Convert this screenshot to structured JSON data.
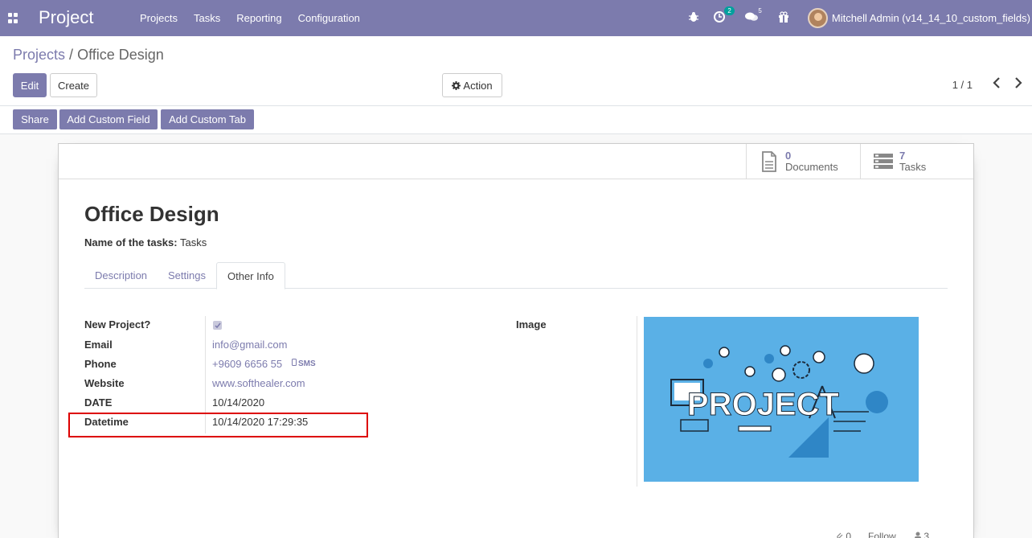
{
  "navbar": {
    "brand": "Project",
    "menu": [
      "Projects",
      "Tasks",
      "Reporting",
      "Configuration"
    ],
    "activity_count": "2",
    "messages_count": "5",
    "user_name": "Mitchell Admin (v14_14_10_custom_fields)"
  },
  "breadcrumb": {
    "parent": "Projects",
    "separator": "/",
    "current": "Office Design"
  },
  "toolbar": {
    "edit": "Edit",
    "create": "Create",
    "action": "Action",
    "pager": "1 / 1",
    "share": "Share",
    "add_custom_field": "Add Custom Field",
    "add_custom_tab": "Add Custom Tab"
  },
  "smart_buttons": {
    "documents": {
      "value": "0",
      "label": "Documents"
    },
    "tasks": {
      "value": "7",
      "label": "Tasks"
    }
  },
  "record": {
    "title": "Office Design",
    "name_of_tasks_label": "Name of the tasks:",
    "name_of_tasks_value": "Tasks"
  },
  "tabs": [
    "Description",
    "Settings",
    "Other Info"
  ],
  "fields": {
    "new_project": {
      "label": "New Project?",
      "checked": true
    },
    "email": {
      "label": "Email",
      "value": "info@gmail.com"
    },
    "phone": {
      "label": "Phone",
      "value": "+9609 6656 55",
      "sms": "SMS"
    },
    "website": {
      "label": "Website",
      "value": "www.softhealer.com"
    },
    "date": {
      "label": "DATE",
      "value": "10/14/2020"
    },
    "datetime": {
      "label": "Datetime",
      "value": "10/14/2020 17:29:35"
    },
    "image": {
      "label": "Image",
      "image_text": "PROJECT"
    }
  },
  "chatter": {
    "attachments": "0",
    "follow": "Follow",
    "followers": "3"
  },
  "colors": {
    "brand": "#7c7bad",
    "image_bg": "#5ab0e6",
    "highlight": "#dd0000"
  }
}
